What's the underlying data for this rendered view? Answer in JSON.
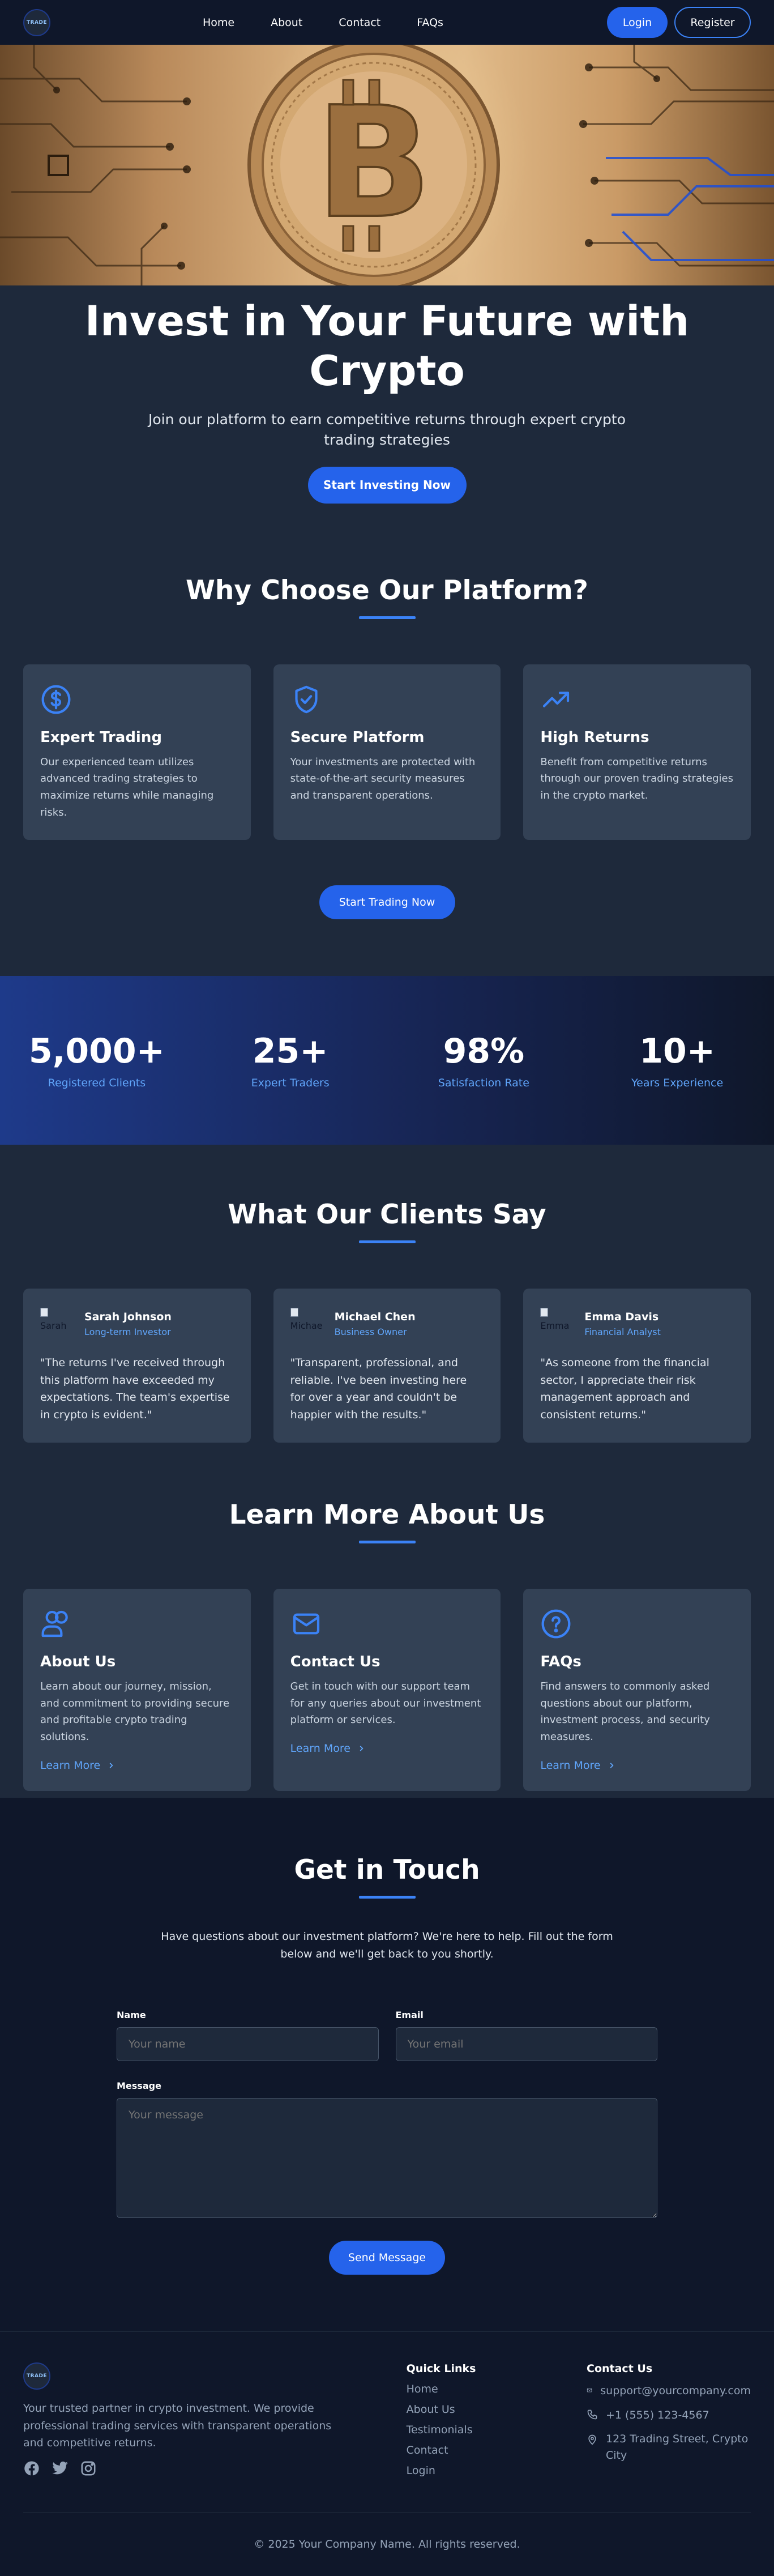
{
  "nav": {
    "logo_text": "TRADE",
    "links": [
      "Home",
      "About",
      "Contact",
      "FAQs"
    ],
    "login": "Login",
    "register": "Register"
  },
  "hero": {
    "title": "Invest in Your Future with Crypto",
    "subtitle": "Join our platform to earn competitive returns through expert crypto trading strategies",
    "cta": "Start Investing Now"
  },
  "why": {
    "title": "Why Choose Our Platform?",
    "cards": [
      {
        "icon": "dollar-circle-icon",
        "title": "Expert Trading",
        "text": "Our experienced team utilizes advanced trading strategies to maximize returns while managing risks."
      },
      {
        "icon": "shield-check-icon",
        "title": "Secure Platform",
        "text": "Your investments are protected with state-of-the-art security measures and transparent operations."
      },
      {
        "icon": "trending-up-icon",
        "title": "High Returns",
        "text": "Benefit from competitive returns through our proven trading strategies in the crypto market."
      }
    ],
    "cta": "Start Trading Now"
  },
  "stats": [
    {
      "value": "5,000+",
      "label": "Registered Clients"
    },
    {
      "value": "25+",
      "label": "Expert Traders"
    },
    {
      "value": "98%",
      "label": "Satisfaction Rate"
    },
    {
      "value": "10+",
      "label": "Years Experience"
    }
  ],
  "testimonials": {
    "title": "What Our Clients Say",
    "items": [
      {
        "alt": "Sarah",
        "name": "Sarah Johnson",
        "role": "Long-term Investor",
        "quote": "\"The returns I've received through this platform have exceeded my expectations. The team's expertise in crypto is evident.\""
      },
      {
        "alt": "Michae",
        "name": "Michael Chen",
        "role": "Business Owner",
        "quote": "\"Transparent, professional, and reliable. I've been investing here for over a year and couldn't be happier with the results.\""
      },
      {
        "alt": "Emma",
        "name": "Emma Davis",
        "role": "Financial Analyst",
        "quote": "\"As someone from the financial sector, I appreciate their risk management approach and consistent returns.\""
      }
    ]
  },
  "learn": {
    "title": "Learn More About Us",
    "link_label": "Learn More",
    "cards": [
      {
        "icon": "users-icon",
        "title": "About Us",
        "text": "Learn about our journey, mission, and commitment to providing secure and profitable crypto trading solutions."
      },
      {
        "icon": "mail-icon",
        "title": "Contact Us",
        "text": "Get in touch with our support team for any queries about our investment platform or services."
      },
      {
        "icon": "question-circle-icon",
        "title": "FAQs",
        "text": "Find answers to commonly asked questions about our platform, investment process, and security measures."
      }
    ]
  },
  "contact": {
    "title": "Get in Touch",
    "intro": "Have questions about our investment platform? We're here to help. Fill out the form below and we'll get back to you shortly.",
    "name_label": "Name",
    "name_placeholder": "Your name",
    "email_label": "Email",
    "email_placeholder": "Your email",
    "message_label": "Message",
    "message_placeholder": "Your message",
    "send": "Send Message"
  },
  "footer": {
    "about": "Your trusted partner in crypto investment. We provide professional trading services with transparent operations and competitive returns.",
    "quick_title": "Quick Links",
    "quick_links": [
      "Home",
      "About Us",
      "Testimonials",
      "Contact",
      "Login"
    ],
    "contact_title": "Contact Us",
    "email": "support@yourcompany.com",
    "phone": "+1 (555) 123-4567",
    "address": "123 Trading Street, Crypto City",
    "copyright": "© 2025 Your Company Name. All rights reserved."
  },
  "colors": {
    "accent": "#2563eb",
    "accent_light": "#60a5fa",
    "bg_dark": "#0f172a",
    "bg_section": "#1e293b",
    "card": "#334155"
  }
}
